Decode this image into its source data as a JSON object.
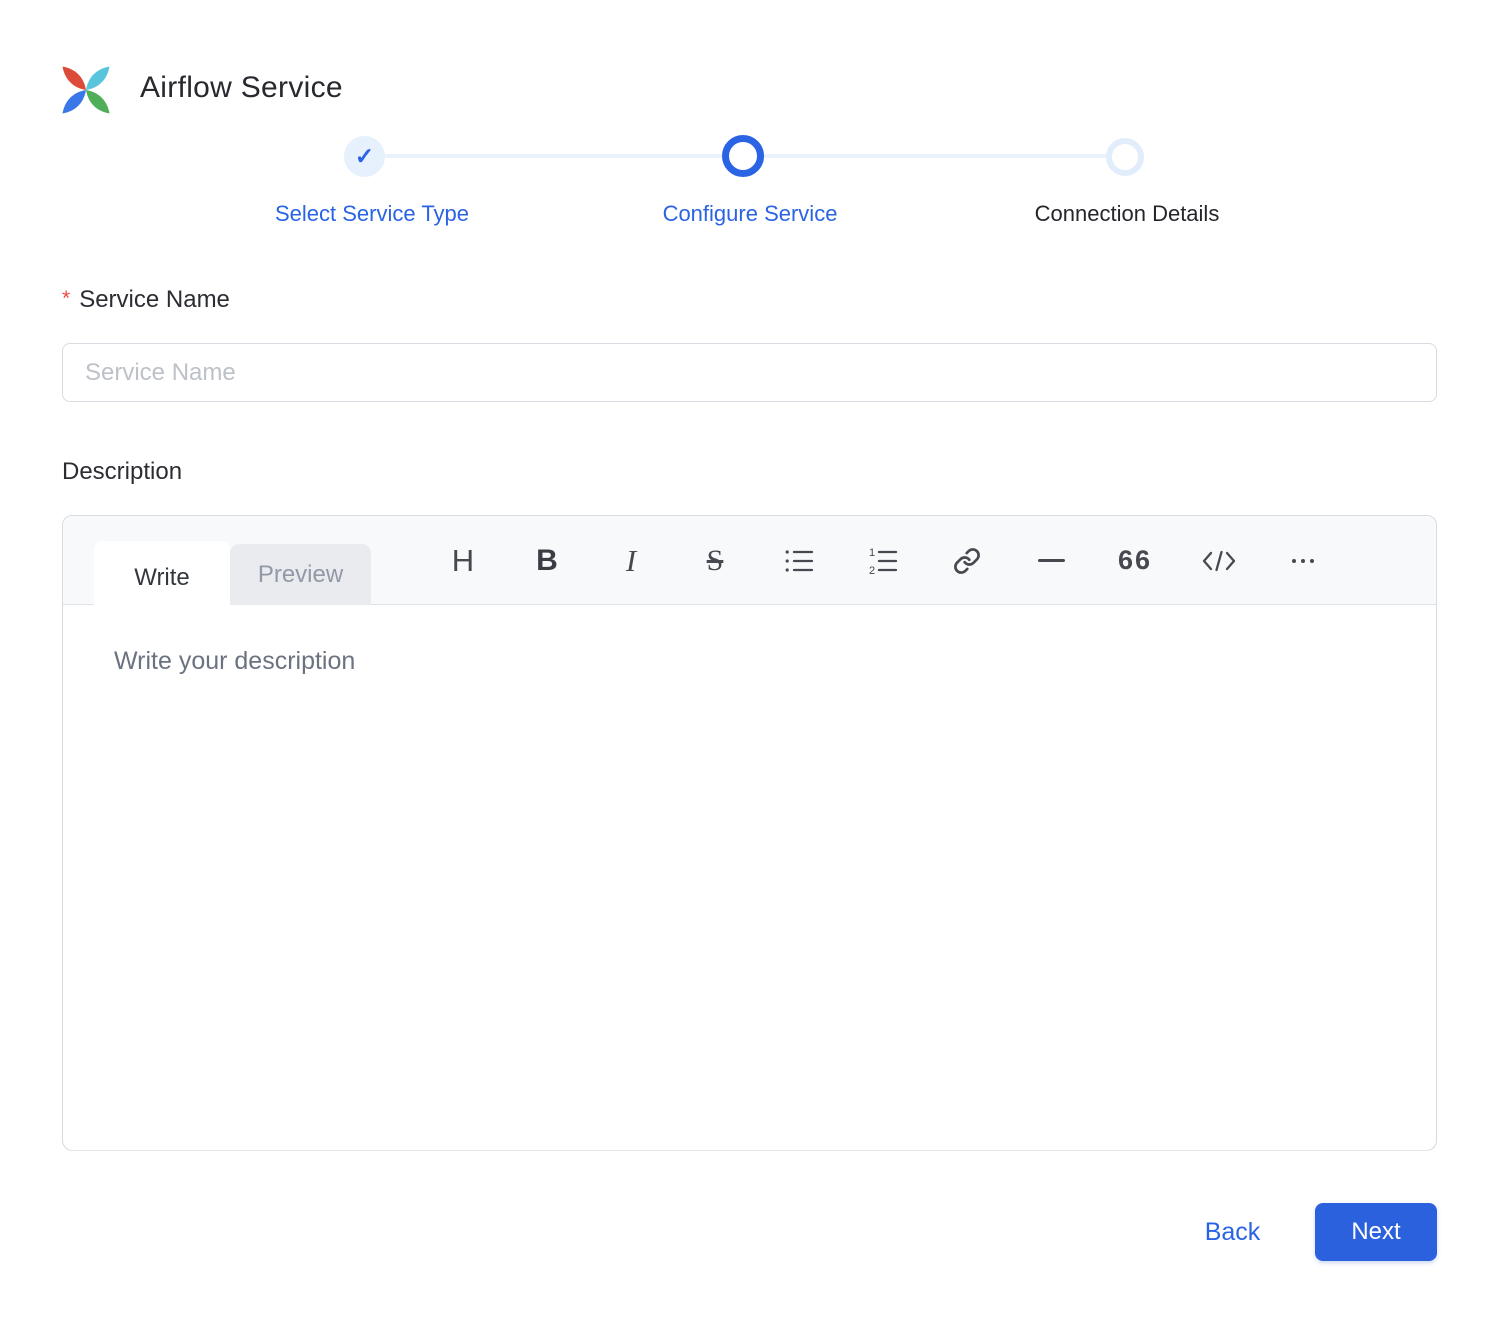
{
  "header": {
    "title": "Airflow Service"
  },
  "stepper": {
    "steps": [
      {
        "label": "Select Service Type",
        "state": "completed"
      },
      {
        "label": "Configure Service",
        "state": "active"
      },
      {
        "label": "Connection Details",
        "state": "upcoming"
      }
    ]
  },
  "form": {
    "service_name": {
      "label": "Service Name",
      "required_marker": "*",
      "placeholder": "Service Name",
      "value": ""
    },
    "description": {
      "label": "Description",
      "editor": {
        "tabs": [
          {
            "label": "Write",
            "active": true
          },
          {
            "label": "Preview",
            "active": false
          }
        ],
        "toolbar": [
          "heading",
          "bold",
          "italic",
          "strikethrough",
          "unordered-list",
          "ordered-list",
          "link",
          "horizontal-rule",
          "quote",
          "code",
          "more-options"
        ],
        "toolbar_glyphs": {
          "heading": "H",
          "bold": "B",
          "italic": "I",
          "strikethrough": "S",
          "quote": "66"
        },
        "placeholder": "Write your description",
        "value": ""
      }
    }
  },
  "footer": {
    "back_label": "Back",
    "next_label": "Next"
  },
  "colors": {
    "primary": "#2a63e4",
    "next_button": "#2c61dd",
    "required_asterisk": "#f0483e",
    "step_completed_bg": "#e7f0fd",
    "step_upcoming_ring": "#e1edfb",
    "stepper_line": "#e9f1fc",
    "editor_header_bg": "#f8f9fb",
    "preview_tab_bg": "#e9ebef",
    "logo_red": "#dc4b37",
    "logo_teal": "#58c5dd",
    "logo_green": "#4fae57",
    "logo_blue": "#3a77e8"
  }
}
